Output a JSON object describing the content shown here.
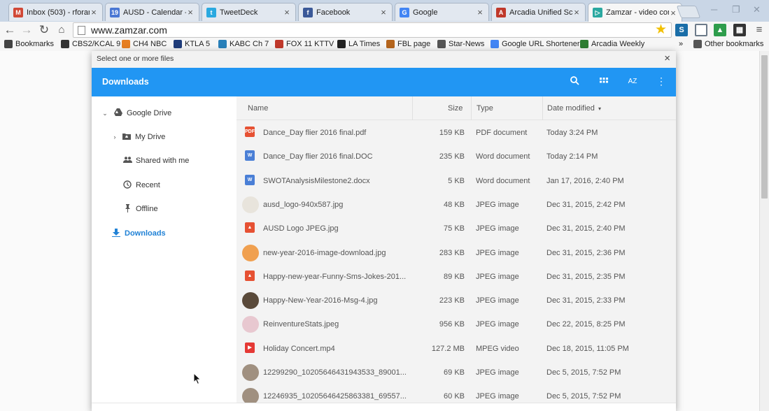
{
  "tabs": [
    {
      "title": "Inbox (503) - rforan",
      "icon": "gmail-icon",
      "color": "#d14836",
      "glyph": "M"
    },
    {
      "title": "AUSD - Calendar - M",
      "icon": "calendar-icon",
      "color": "#4a77d4",
      "glyph": "19"
    },
    {
      "title": "TweetDeck",
      "icon": "tweetdeck-icon",
      "color": "#2aa9e0",
      "glyph": "t"
    },
    {
      "title": "Facebook",
      "icon": "facebook-icon",
      "color": "#3b5998",
      "glyph": "f"
    },
    {
      "title": "Google",
      "icon": "google-icon",
      "color": "#4285f4",
      "glyph": "G"
    },
    {
      "title": "Arcadia Unified Sch",
      "icon": "arcadia-icon",
      "color": "#c0392b",
      "glyph": "A"
    },
    {
      "title": "Zamzar - video con",
      "icon": "zamzar-icon",
      "color": "#2aa8a0",
      "glyph": "▷"
    }
  ],
  "omnibox": {
    "url": "www.zamzar.com"
  },
  "bookmarks": [
    {
      "label": "Bookmarks",
      "icon": "star-icon",
      "color": "#444"
    },
    {
      "label": "CBS2/KCAL 9",
      "icon": "cbs-icon",
      "color": "#333"
    },
    {
      "label": "CH4 NBC",
      "icon": "nbc-icon",
      "color": "#e67e22"
    },
    {
      "label": "KTLA 5",
      "icon": "ktla-icon",
      "color": "#1f3c7a"
    },
    {
      "label": "KABC Ch 7",
      "icon": "kabc-icon",
      "color": "#2980b9"
    },
    {
      "label": "FOX 11 KTTV",
      "icon": "fox-icon",
      "color": "#c0392b"
    },
    {
      "label": "LA Times",
      "icon": "latimes-icon",
      "color": "#222"
    },
    {
      "label": "FBL page",
      "icon": "fbl-icon",
      "color": "#b5651d"
    },
    {
      "label": "Star-News",
      "icon": "starnews-icon",
      "color": "#555"
    },
    {
      "label": "Google URL Shortener",
      "icon": "google-icon",
      "color": "#4285f4"
    },
    {
      "label": "Arcadia Weekly",
      "icon": "arcadia-weekly-icon",
      "color": "#2e7d32"
    },
    {
      "label": "»",
      "icon": "more-bookmarks-icon",
      "color": "#444"
    },
    {
      "label": "Other bookmarks",
      "icon": "folder-icon",
      "color": "#555"
    }
  ],
  "dialog": {
    "title": "Select one or more files",
    "close": "×",
    "header_title": "Downloads",
    "sort_label": "AZ"
  },
  "sidebar": {
    "google_drive": "Google Drive",
    "my_drive": "My Drive",
    "shared_with_me": "Shared with me",
    "recent": "Recent",
    "offline": "Offline",
    "downloads": "Downloads"
  },
  "columns": {
    "name": "Name",
    "size": "Size",
    "type": "Type",
    "date": "Date modified",
    "sort_arrow": "▾"
  },
  "files": [
    {
      "name": "Dance_Day flier 2016 final.pdf",
      "size": "159 KB",
      "type": "PDF document",
      "date": "Today 3:24 PM",
      "kind": "pdf"
    },
    {
      "name": "Dance_Day flier 2016 final.DOC",
      "size": "235 KB",
      "type": "Word document",
      "date": "Today 2:14 PM",
      "kind": "word"
    },
    {
      "name": "SWOTAnalysisMilestone2.docx",
      "size": "5 KB",
      "type": "Word document",
      "date": "Jan 17, 2016, 2:40 PM",
      "kind": "word"
    },
    {
      "name": "ausd_logo-940x587.jpg",
      "size": "48 KB",
      "type": "JPEG image",
      "date": "Dec 31, 2015, 2:42 PM",
      "kind": "thumb-light"
    },
    {
      "name": "AUSD Logo JPEG.jpg",
      "size": "75 KB",
      "type": "JPEG image",
      "date": "Dec 31, 2015, 2:40 PM",
      "kind": "image"
    },
    {
      "name": "new-year-2016-image-download.jpg",
      "size": "283 KB",
      "type": "JPEG image",
      "date": "Dec 31, 2015, 2:36 PM",
      "kind": "thumb-orange"
    },
    {
      "name": "Happy-new-year-Funny-Sms-Jokes-201...",
      "size": "89 KB",
      "type": "JPEG image",
      "date": "Dec 31, 2015, 2:35 PM",
      "kind": "image"
    },
    {
      "name": "Happy-New-Year-2016-Msg-4.jpg",
      "size": "223 KB",
      "type": "JPEG image",
      "date": "Dec 31, 2015, 2:33 PM",
      "kind": "thumb-dark"
    },
    {
      "name": "ReinventureStats.jpeg",
      "size": "956 KB",
      "type": "JPEG image",
      "date": "Dec 22, 2015, 8:25 PM",
      "kind": "thumb-pink"
    },
    {
      "name": "Holiday Concert.mp4",
      "size": "127.2 MB",
      "type": "MPEG video",
      "date": "Dec 18, 2015, 11:05 PM",
      "kind": "video"
    },
    {
      "name": "12299290_10205646431943533_89001...",
      "size": "69 KB",
      "type": "JPEG image",
      "date": "Dec 5, 2015, 7:52 PM",
      "kind": "thumb-grey"
    },
    {
      "name": "12246935_10205646425863381_69557...",
      "size": "60 KB",
      "type": "JPEG image",
      "date": "Dec 5, 2015, 7:52 PM",
      "kind": "thumb-grey"
    }
  ],
  "colors": {
    "accent": "#2196f3",
    "active_nav": "#2182d6",
    "pdf": "#e65133",
    "word": "#4a7fd6",
    "image": "#e65133",
    "video": "#e53935"
  }
}
